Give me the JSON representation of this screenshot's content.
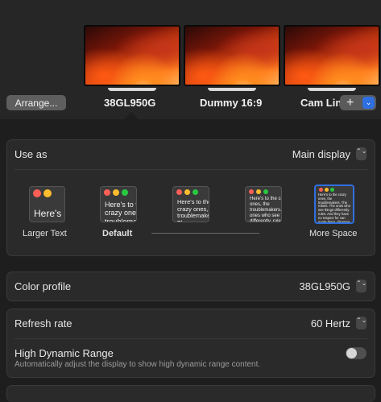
{
  "displays": {
    "arrange_label": "Arrange...",
    "plus_symbol": "+",
    "chevron_symbol": "⌄",
    "items": [
      {
        "label": "38GL950G",
        "selected": true
      },
      {
        "label": "Dummy 16:9",
        "selected": false
      },
      {
        "label": "Cam Link",
        "selected": false
      }
    ]
  },
  "use_as": {
    "label": "Use as",
    "value": "Main display",
    "stepper_symbol": "⌃⌄"
  },
  "resolution": {
    "options": [
      {
        "label": "Larger Text",
        "preview": "Here's",
        "selected": false
      },
      {
        "label": "Default",
        "preview": "Here's to the crazy ones troublemakers",
        "selected": false
      },
      {
        "label": "",
        "preview": "Here's to the crazy ones, the troublemakers. The ones who see",
        "selected": false
      },
      {
        "label": "",
        "preview": "Here's to the crazy ones, the troublemakers. The ones who see things differently. rules. And they have",
        "selected": false
      },
      {
        "label": "More Space",
        "preview": "Here's to the crazy ones, the troublemakers. The rebels. The ones who see things differently. rules. And they have no respect for can quote them, disagree with them. About the only thing you can't do is because they change things.",
        "selected": true
      }
    ]
  },
  "color_profile": {
    "label": "Color profile",
    "value": "38GL950G",
    "stepper_symbol": "⌃⌄"
  },
  "refresh_rate": {
    "label": "Refresh rate",
    "value": "60 Hertz",
    "stepper_symbol": "⌃⌄"
  },
  "hdr": {
    "label": "High Dynamic Range",
    "description": "Automatically adjust the display to show high dynamic range content.",
    "enabled": false
  },
  "colors": {
    "accent": "#2f6fe0",
    "background": "#1e1e1e",
    "card": "#2a2a2a"
  }
}
